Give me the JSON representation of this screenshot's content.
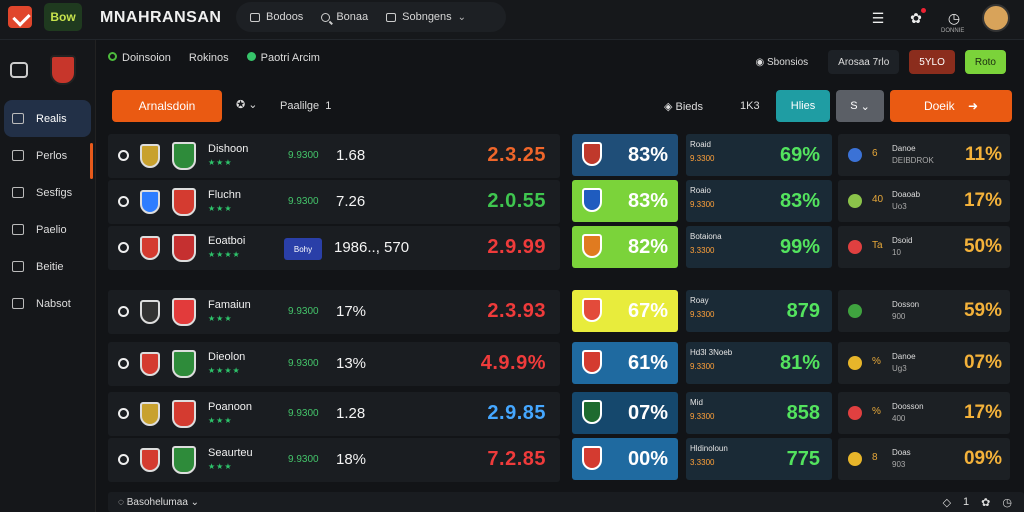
{
  "header": {
    "title": "MNAHRANSAN",
    "logo_text": "Bow",
    "nav": [
      {
        "label": "Bodoos",
        "icon": "square-icon"
      },
      {
        "label": "Bonaa",
        "icon": "search-icon"
      },
      {
        "label": "Sobngens",
        "icon": "square-icon"
      }
    ],
    "icons": [
      "menu-icon",
      "gear-icon",
      "clock-icon",
      "avatar"
    ],
    "clock_caption": "DONNIE"
  },
  "sidebar": {
    "items": [
      {
        "label": "Realis",
        "active": true
      },
      {
        "label": "Perlos",
        "active": false
      },
      {
        "label": "Sesfigs",
        "active": false
      },
      {
        "label": "Paelio",
        "active": false
      },
      {
        "label": "Beitie",
        "active": false
      },
      {
        "label": "Nabsot",
        "active": false
      }
    ]
  },
  "filters": {
    "left": [
      {
        "label": "Doinsoion"
      },
      {
        "label": "Rokinos"
      },
      {
        "label": "Paotri Arcim"
      }
    ],
    "right": [
      {
        "label": "Sbonsios"
      },
      {
        "label": "Arosaa 7rlo"
      },
      {
        "label": "5YLO"
      },
      {
        "label": "Roto"
      }
    ]
  },
  "actions": {
    "primary": "Arnalsdoin",
    "sort_label": "Paalilge",
    "sort_value": "1",
    "stats_label": "Bieds",
    "stats_value": "1K3",
    "teal": "Hlies",
    "grey": "S",
    "cta": "Doeik"
  },
  "colors": {
    "accent": "#ea5a12",
    "green": "#4ccf5a",
    "red": "#e2392b",
    "blue": "#2d7dff"
  },
  "rows": [
    {
      "team": "Dishoon",
      "stars": "★★★",
      "odds": "9.9300",
      "main": "1.68",
      "score": "2.3.25",
      "score_color": "#f0662a",
      "mid_bg": "#1f4e78",
      "mid_pct": "83%",
      "det_title": "Roaid",
      "det_sub": "9.3300",
      "det_val": "69%",
      "r_label": "Danoe",
      "r_sub": "DEIBDROK",
      "r_num": "6",
      "r_val": "11%",
      "r_dot": "#3b72d6"
    },
    {
      "team": "Fluchn",
      "stars": "★★★",
      "odds": "9.9300",
      "main": "7.26",
      "score": "2.0.55",
      "score_color": "#3fc64f",
      "mid_bg": "#7bd33a",
      "mid_pct": "83%",
      "det_title": "Roaio",
      "det_sub": "9.3300",
      "det_val": "83%",
      "r_label": "Doaoab",
      "r_sub": "Uo3",
      "r_num": "40",
      "r_val": "17%",
      "r_dot": "#8bc34a"
    },
    {
      "team": "Eoatboi",
      "stars": "★★★★",
      "odds": "",
      "main": "1986.., 570",
      "score": "2.9.99",
      "score_color": "#ef3b3b",
      "mid_bg": "#7bd33a",
      "mid_pct": "82%",
      "det_title": "Botaiona",
      "det_sub": "3.3300",
      "det_val": "99%",
      "r_label": "Dsoid",
      "r_sub": "10",
      "r_num": "Ta",
      "r_val": "50%",
      "r_dot": "#e04040",
      "badge": "Bohy"
    },
    {
      "team": "Famaiun",
      "stars": "★★★",
      "odds": "9.9300",
      "main": "17%",
      "score": "2.3.93",
      "score_color": "#ef3b3b",
      "mid_bg": "#e8ec3c",
      "mid_pct": "67%",
      "det_title": "Roay",
      "det_sub": "9.3300",
      "det_val": "879",
      "r_label": "Dosson",
      "r_sub": "900",
      "r_num": "",
      "r_val": "59%",
      "r_dot": "#3fa33f"
    },
    {
      "team": "Dieolon",
      "stars": "★★★★",
      "odds": "9.9300",
      "main": "13%",
      "score": "4.9.9%",
      "score_color": "#ef3b3b",
      "mid_bg": "#1f6aa0",
      "mid_pct": "61%",
      "det_title": "Hd3l 3Noeb",
      "det_sub": "9.3300",
      "det_val": "81%",
      "r_label": "Danoe",
      "r_sub": "Ug3",
      "r_num": "%",
      "r_val": "07%",
      "r_dot": "#e7b52a"
    },
    {
      "team": "Poanoon",
      "stars": "★★★",
      "odds": "9.9300",
      "main": "1.28",
      "score": "2.9.85",
      "score_color": "#45a7ff",
      "mid_bg": "#15486d",
      "mid_pct": "07%",
      "det_title": "Mid",
      "det_sub": "9.3300",
      "det_val": "858",
      "r_label": "Doosson",
      "r_sub": "400",
      "r_num": "%",
      "r_val": "17%",
      "r_dot": "#e04040"
    },
    {
      "team": "Seaurteu",
      "stars": "★★★",
      "odds": "9.9300",
      "main": "18%",
      "score": "7.2.85",
      "score_color": "#ef3b3b",
      "mid_bg": "#1f6aa0",
      "mid_pct": "00%",
      "det_title": "Hldinoloun",
      "det_sub": "3.3300",
      "det_val": "775",
      "r_label": "Doas",
      "r_sub": "903",
      "r_num": "8",
      "r_val": "09%",
      "r_dot": "#e7b52a"
    }
  ],
  "footer": {
    "left": "Basohelumaa",
    "right_num": "1"
  }
}
